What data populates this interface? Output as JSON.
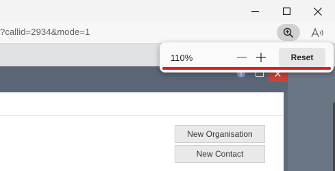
{
  "window": {
    "minimize_icon": "minimize-icon",
    "maximize_icon": "maximize-icon",
    "close_icon": "close-icon"
  },
  "address_bar": {
    "url_fragment": "?callid=2934&mode=1",
    "zoom_icon": "zoom-in-icon",
    "read_aloud_icon": "read-aloud-icon"
  },
  "zoom_popup": {
    "value": "110%",
    "minus_icon": "minus-icon",
    "plus_icon": "plus-icon",
    "reset_label": "Reset",
    "highlight_color": "#e02020"
  },
  "dialog": {
    "info_badge": "i",
    "close_glyph": "✕",
    "buttons": [
      {
        "label": "New Organisation"
      },
      {
        "label": "New Contact"
      }
    ]
  }
}
